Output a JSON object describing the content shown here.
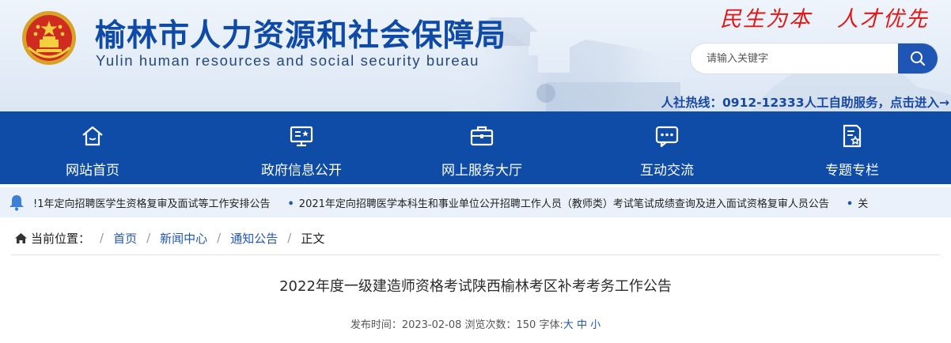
{
  "header": {
    "title": "榆林市人力资源和社会保障局",
    "subtitle": "Yulin human resources and social security bureau",
    "slogan": "民生为本   人才优先",
    "search_placeholder": "请输入关键字",
    "hotline": "人社热线：0912-12333人工自助服务，点击进入→"
  },
  "nav": {
    "items": [
      {
        "label": "网站首页",
        "icon": "home-icon"
      },
      {
        "label": "政府信息公开",
        "icon": "info-board-icon"
      },
      {
        "label": "网上服务大厅",
        "icon": "briefcase-icon"
      },
      {
        "label": "互动交流",
        "icon": "chat-icon"
      },
      {
        "label": "专题专栏",
        "icon": "document-star-icon"
      }
    ]
  },
  "ticker": {
    "items": [
      "!1年定向招聘医学生资格复审及面试等工作安排公告",
      "2021年定向招聘医学本科生和事业单位公开招聘工作人员（教师类）考试笔试成绩查询及进入面试资格复审人员公告",
      "关"
    ]
  },
  "breadcrumb": {
    "label": "当前位置：",
    "items": [
      "首页",
      "新闻中心",
      "通知公告"
    ],
    "current": "正文"
  },
  "article": {
    "title": "2022年度一级建造师资格考试陕西榆林考区补考考务工作公告",
    "meta_prefix": "发布时间：2023-02-08 浏览次数：150 字体:",
    "font_sizes": [
      "大",
      "中",
      "小"
    ]
  },
  "colors": {
    "brand_blue": "#0f4ca8",
    "title_blue": "#0f4aa6",
    "slogan_red": "#e01818",
    "ticker_bg": "#eaf1fa"
  }
}
